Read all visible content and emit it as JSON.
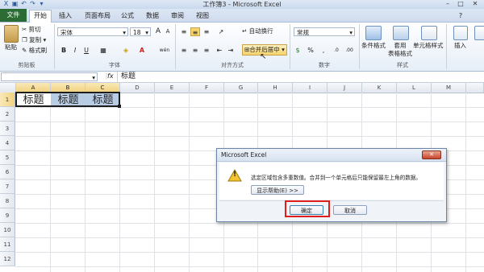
{
  "window": {
    "title": "工作簿3 - Microsoft Excel",
    "min_glyph": "–",
    "max_glyph": "□",
    "close_glyph": "✕"
  },
  "quick_access": {
    "save": "▣",
    "undo": "↶",
    "redo": "↷",
    "more": "▾"
  },
  "tabs": [
    "文件",
    "开始",
    "插入",
    "页面布局",
    "公式",
    "数据",
    "审阅",
    "视图"
  ],
  "ribbon": {
    "clipboard": {
      "paste": "粘贴",
      "cut": "剪切",
      "copy": "复制",
      "format_painter": "格式刷",
      "label": "剪贴板"
    },
    "font": {
      "name": "宋体",
      "size": "18",
      "grow": "A",
      "shrink": "A",
      "bold": "B",
      "italic": "I",
      "underline": "U",
      "label": "字体",
      "font_color_letter": "A",
      "wen": "wén"
    },
    "alignment": {
      "wrap_text": "自动换行",
      "merge_center": "合并后居中",
      "label": "对齐方式"
    },
    "number": {
      "format": "常规",
      "currency": "%",
      "comma": ",",
      "label": "数字",
      "inc_decimal": ".0",
      "dec_decimal": ".00"
    },
    "styles": {
      "conditional": "条件格式",
      "table_format": "套用\n表格格式",
      "cell_styles": "单元格样式",
      "label": "样式"
    },
    "cells": {
      "insert": "插入"
    }
  },
  "formula_bar": {
    "name_box": "",
    "fx": "fx",
    "content": "标题"
  },
  "columns": [
    "A",
    "B",
    "C",
    "D",
    "E",
    "F",
    "G",
    "H",
    "I",
    "J",
    "K",
    "L",
    "M"
  ],
  "rows": [
    "1",
    "2",
    "3",
    "4",
    "5",
    "6",
    "7",
    "8",
    "9",
    "10",
    "11",
    "12"
  ],
  "cells": {
    "A1": "标题",
    "B1": "标题",
    "C1": "标题"
  },
  "dialog": {
    "title": "Microsoft Excel",
    "message": "选定区域包含多重数值。合并到一个单元格后只能保留最左上角的数据。",
    "help_button": "显示帮助(E) >>",
    "ok_button": "确定",
    "cancel_button": "取消",
    "close_glyph": "✕",
    "warning_glyph": "!"
  },
  "colors": {
    "file_tab": "#2b6b34",
    "selection_fill": "#b8cce4",
    "highlight_box": "#e01d1d",
    "warning_yellow": "#f4c430"
  }
}
